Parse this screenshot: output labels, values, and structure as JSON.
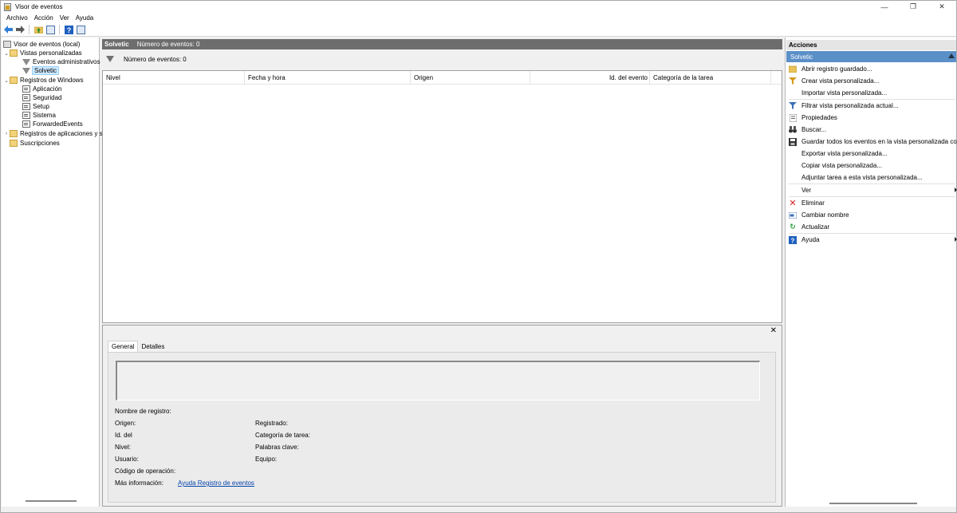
{
  "window": {
    "title": "Visor de eventos",
    "controls": [
      "—",
      "❐",
      "✕"
    ]
  },
  "menu": [
    "Archivo",
    "Acción",
    "Ver",
    "Ayuda"
  ],
  "tree": {
    "root": "Visor de eventos (local)",
    "custom_views": "Vistas personalizadas",
    "admin_events": "Eventos administrativos",
    "solvetic": "Solvetic",
    "windows_logs": "Registros de Windows",
    "application": "Aplicación",
    "security": "Seguridad",
    "setup": "Setup",
    "system": "Sistema",
    "forwarded": "ForwardedEvents",
    "app_services_logs": "Registros de aplicaciones y s",
    "subscriptions": "Suscripciones"
  },
  "center": {
    "header_name": "Solvetic",
    "header_count": "Número de eventos: 0",
    "filter_count": "Número de eventos: 0",
    "columns": [
      "Nivel",
      "Fecha y hora",
      "Origen",
      "Id. del evento",
      "Categoría de la tarea"
    ]
  },
  "preview": {
    "tabs": [
      "General",
      "Detalles"
    ],
    "fields": {
      "log_name": "Nombre de registro:",
      "source": "Origen:",
      "event_id": "Id. del",
      "level": "Nivel:",
      "user": "Usuario:",
      "opcode": "Código de operación:",
      "more_info": "Más información:",
      "more_info_link": "Ayuda Registro de eventos",
      "logged": "Registrado:",
      "task_category": "Categoría de tarea:",
      "keywords": "Palabras clave:",
      "computer": "Equipo:"
    }
  },
  "actions": {
    "header": "Acciones",
    "section": "Solvetic",
    "items": [
      "Abrir registro guardado...",
      "Crear vista personalizada...",
      "Importar vista personalizada...",
      "Filtrar vista personalizada actual...",
      "Propiedades",
      "Buscar...",
      "Guardar todos los eventos en la vista personalizada co...",
      "Exportar vista personalizada...",
      "Copiar vista personalizada...",
      "Adjuntar tarea a esta vista personalizada...",
      "Ver",
      "Eliminar",
      "Cambiar nombre",
      "Actualizar",
      "Ayuda"
    ]
  },
  "colors": {
    "header_gray": "#6d6d6d",
    "actions_section": "#5b8fc7",
    "link": "#0645ad"
  }
}
